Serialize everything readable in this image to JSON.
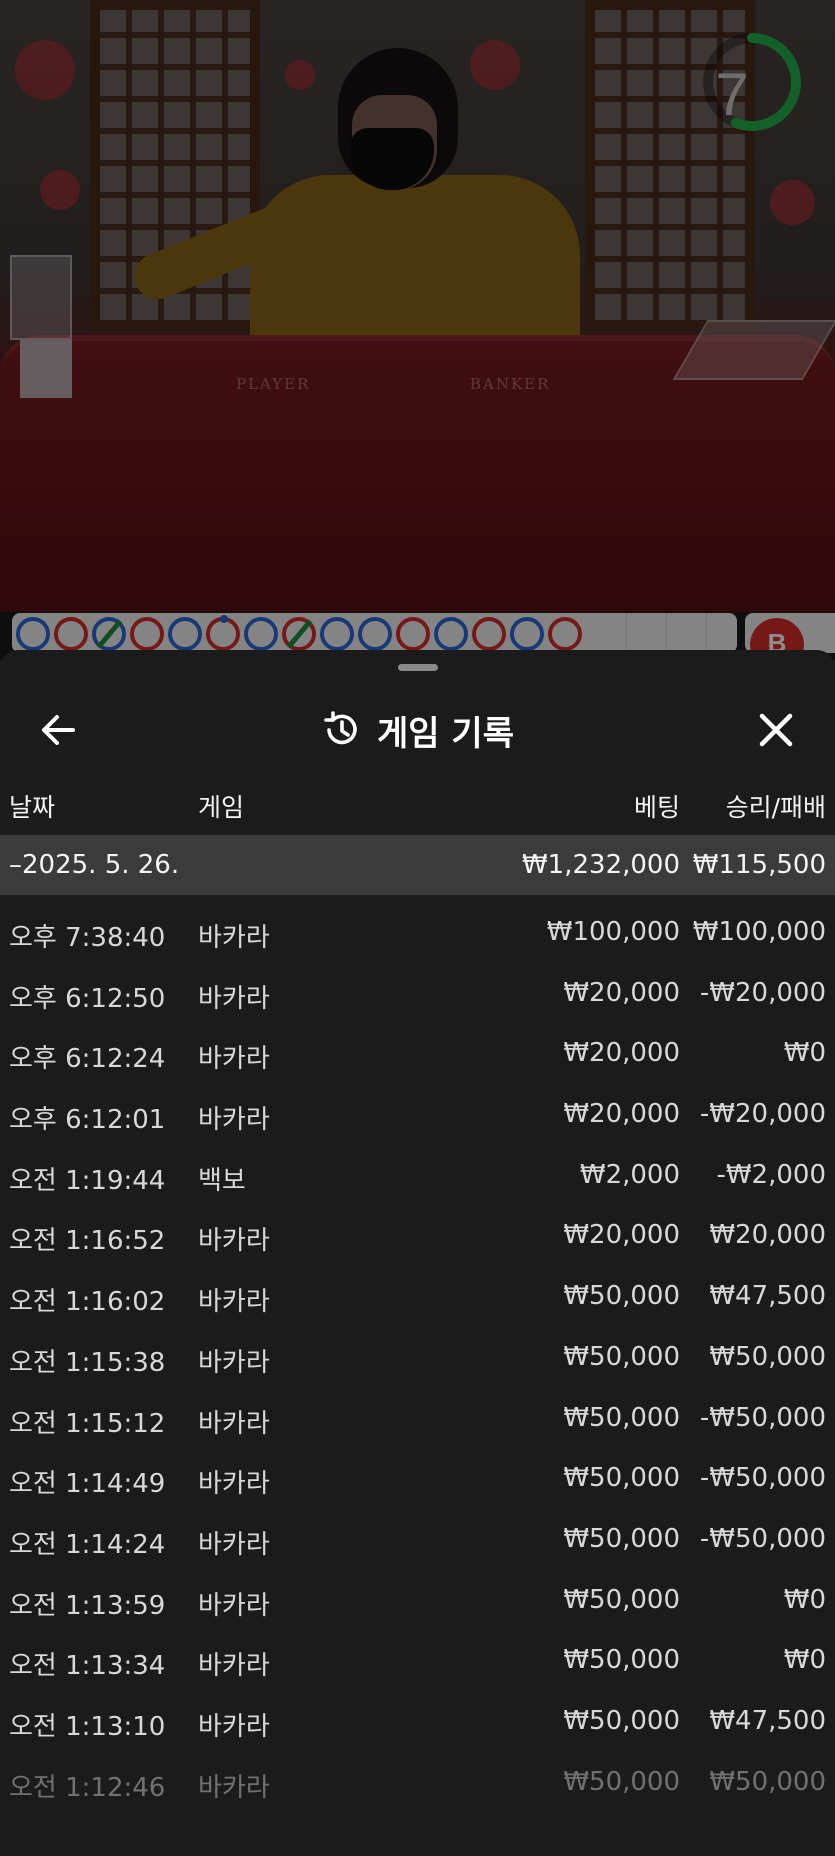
{
  "timer": {
    "value": "7",
    "color": "#23b04a"
  },
  "table_labels": {
    "player": "PLAYER",
    "banker": "BANKER"
  },
  "road": {
    "cells": [
      "blue",
      "red",
      "blue-slash",
      "red",
      "blue",
      "red-dot",
      "blue",
      "red-slash",
      "blue",
      "blue",
      "red",
      "blue",
      "red",
      "blue",
      "red"
    ],
    "side_badge": "B"
  },
  "header": {
    "title": "게임 기록",
    "back_icon": "arrow-left-icon",
    "history_icon": "history-icon",
    "close_icon": "close-icon"
  },
  "columns": {
    "date": "날짜",
    "game": "게임",
    "bet": "베팅",
    "result": "승리/패배"
  },
  "summary": {
    "date": "–2025. 5. 26.",
    "bet": "₩1,232,000",
    "result": "₩115,500"
  },
  "rows": [
    {
      "time": "오후 7:38:40",
      "game": "바카라",
      "bet": "₩100,000",
      "result": "₩100,000"
    },
    {
      "time": "오후 6:12:50",
      "game": "바카라",
      "bet": "₩20,000",
      "result": "-₩20,000"
    },
    {
      "time": "오후 6:12:24",
      "game": "바카라",
      "bet": "₩20,000",
      "result": "₩0"
    },
    {
      "time": "오후 6:12:01",
      "game": "바카라",
      "bet": "₩20,000",
      "result": "-₩20,000"
    },
    {
      "time": "오전 1:19:44",
      "game": "백보",
      "bet": "₩2,000",
      "result": "-₩2,000"
    },
    {
      "time": "오전 1:16:52",
      "game": "바카라",
      "bet": "₩20,000",
      "result": "₩20,000"
    },
    {
      "time": "오전 1:16:02",
      "game": "바카라",
      "bet": "₩50,000",
      "result": "₩47,500"
    },
    {
      "time": "오전 1:15:38",
      "game": "바카라",
      "bet": "₩50,000",
      "result": "₩50,000"
    },
    {
      "time": "오전 1:15:12",
      "game": "바카라",
      "bet": "₩50,000",
      "result": "-₩50,000"
    },
    {
      "time": "오전 1:14:49",
      "game": "바카라",
      "bet": "₩50,000",
      "result": "-₩50,000"
    },
    {
      "time": "오전 1:14:24",
      "game": "바카라",
      "bet": "₩50,000",
      "result": "-₩50,000"
    },
    {
      "time": "오전 1:13:59",
      "game": "바카라",
      "bet": "₩50,000",
      "result": "₩0"
    },
    {
      "time": "오전 1:13:34",
      "game": "바카라",
      "bet": "₩50,000",
      "result": "₩0"
    },
    {
      "time": "오전 1:13:10",
      "game": "바카라",
      "bet": "₩50,000",
      "result": "₩47,500"
    },
    {
      "time": "오전 1:12:46",
      "game": "바카라",
      "bet": "₩50,000",
      "result": "₩50,000"
    }
  ]
}
